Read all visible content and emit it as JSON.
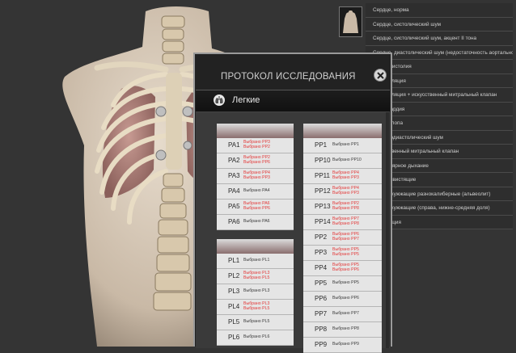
{
  "protocol": {
    "title": "ПРОТОКОЛ ИССЛЕДОВАНИЯ",
    "section": "Легкие",
    "left_top": [
      {
        "label": "PA1",
        "values": [
          {
            "t": "Выбрано PP3",
            "c": "red"
          },
          {
            "t": "Выбрано PP2",
            "c": "red"
          }
        ]
      },
      {
        "label": "PA2",
        "values": [
          {
            "t": "Выбрано PP2",
            "c": "red"
          },
          {
            "t": "Выбрано PP6",
            "c": "red"
          }
        ]
      },
      {
        "label": "PA3",
        "values": [
          {
            "t": "Выбрано PP4",
            "c": "red"
          },
          {
            "t": "Выбрано PP3",
            "c": "red"
          }
        ]
      },
      {
        "label": "PA4",
        "values": [
          {
            "t": "Выбрано PA4",
            "c": "dark"
          }
        ]
      },
      {
        "label": "PA5",
        "values": [
          {
            "t": "Выбрано PA6",
            "c": "red"
          },
          {
            "t": "Выбрано PP6",
            "c": "red"
          }
        ]
      },
      {
        "label": "PA6",
        "values": [
          {
            "t": "Выбрано PA6",
            "c": "dark"
          }
        ]
      }
    ],
    "left_bottom": [
      {
        "label": "PL1",
        "values": [
          {
            "t": "Выбрано PL1",
            "c": "dark"
          }
        ]
      },
      {
        "label": "PL2",
        "values": [
          {
            "t": "Выбрано PL3",
            "c": "red"
          },
          {
            "t": "Выбрано PL5",
            "c": "red"
          }
        ]
      },
      {
        "label": "PL3",
        "values": [
          {
            "t": "Выбрано PL3",
            "c": "dark"
          }
        ]
      },
      {
        "label": "PL4",
        "values": [
          {
            "t": "Выбрано PL3",
            "c": "red"
          },
          {
            "t": "Выбрано PL5",
            "c": "red"
          }
        ]
      },
      {
        "label": "PL5",
        "values": [
          {
            "t": "Выбрано PL5",
            "c": "dark"
          }
        ]
      },
      {
        "label": "PL6",
        "values": [
          {
            "t": "Выбрано PL6",
            "c": "dark"
          }
        ]
      }
    ],
    "right": [
      {
        "label": "PP1",
        "values": [
          {
            "t": "Выбрано PP1",
            "c": "dark"
          }
        ]
      },
      {
        "label": "PP10",
        "values": [
          {
            "t": "Выбрано PP10",
            "c": "dark"
          }
        ]
      },
      {
        "label": "PP11",
        "values": [
          {
            "t": "Выбрано PP4",
            "c": "red"
          },
          {
            "t": "Выбрано PP3",
            "c": "red"
          }
        ]
      },
      {
        "label": "PP12",
        "values": [
          {
            "t": "Выбрано PP4",
            "c": "red"
          },
          {
            "t": "Выбрано PP3",
            "c": "red"
          }
        ]
      },
      {
        "label": "PP13",
        "values": [
          {
            "t": "Выбрано PP2",
            "c": "red"
          },
          {
            "t": "Выбрано PP8",
            "c": "red"
          }
        ]
      },
      {
        "label": "PP14",
        "values": [
          {
            "t": "Выбрано PP7",
            "c": "red"
          },
          {
            "t": "Выбрано PP8",
            "c": "red"
          }
        ]
      },
      {
        "label": "PP2",
        "values": [
          {
            "t": "Выбрано PP6",
            "c": "red"
          },
          {
            "t": "Выбрано PP7",
            "c": "red"
          }
        ]
      },
      {
        "label": "PP3",
        "values": [
          {
            "t": "Выбрано PP5",
            "c": "red"
          },
          {
            "t": "Выбрано PP5",
            "c": "red"
          }
        ]
      },
      {
        "label": "PP4",
        "values": [
          {
            "t": "Выбрано PP5",
            "c": "red"
          },
          {
            "t": "Выбрано PP6",
            "c": "red"
          }
        ]
      },
      {
        "label": "PP5",
        "values": [
          {
            "t": "Выбрано PP5",
            "c": "dark"
          }
        ]
      },
      {
        "label": "PP6",
        "values": [
          {
            "t": "Выбрано PP6",
            "c": "dark"
          }
        ]
      },
      {
        "label": "PP7",
        "values": [
          {
            "t": "Выбрано PP7",
            "c": "dark"
          }
        ]
      },
      {
        "label": "PP8",
        "values": [
          {
            "t": "Выбрано PP8",
            "c": "dark"
          }
        ]
      },
      {
        "label": "PP9",
        "values": [
          {
            "t": "Выбрано PP9",
            "c": "dark"
          }
        ]
      }
    ]
  },
  "sound_list": [
    "Сердце, норма",
    "Сердце, систолический шум",
    "Сердце, систолический шум, акцент II тона",
    "Сердце, диастолический шум (недостаточность аортального клапана)",
    "Экстрасистолия",
    "Фибрилляция",
    "Фибрилляция + искусственный митральный клапан",
    "Брадикардия",
    "Ритм галопа",
    "Систолодиастолический шум",
    "Искусственный митральный клапан",
    "Везикулярное дыхание",
    "Хрипы свистящие",
    "Хрипы жужжащие разнокалиберные (альвеолит)",
    "Хрипы жужжащие (справа, нижне-средняя доля)",
    "Крепитация"
  ],
  "colors": {
    "accent_red": "#e43a3a",
    "panel_bg": "#222222",
    "page_bg": "#343434"
  }
}
